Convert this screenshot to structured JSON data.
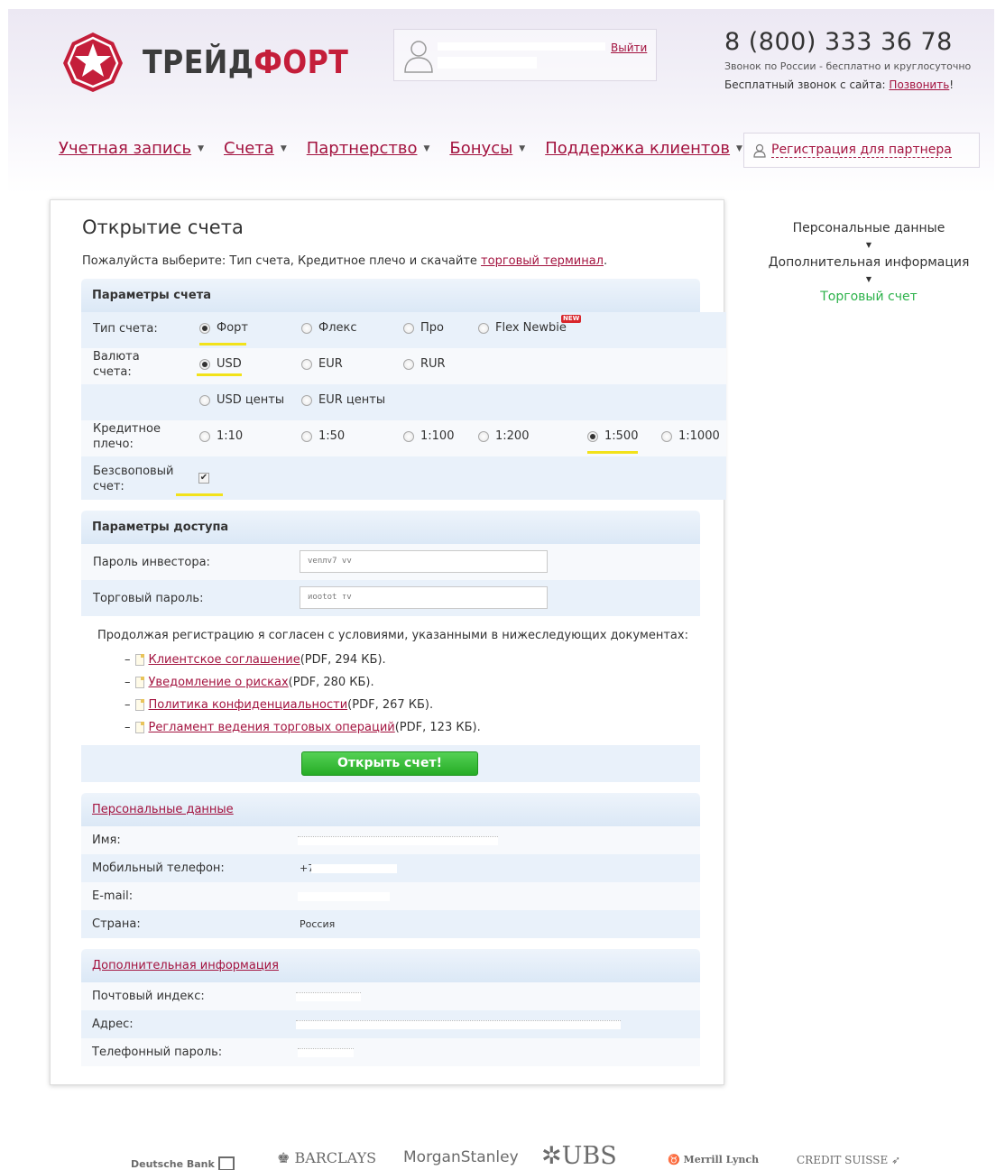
{
  "brand": {
    "name_part1": "ТРЕЙД",
    "name_part2": "ФОРТ",
    "accent_color": "#c41e3a"
  },
  "user": {
    "logout": "Выйти"
  },
  "contact": {
    "phone": "8 (800) 333 36 78",
    "sub1": "Звонок по России - бесплатно и круглосуточно",
    "sub2_prefix": "Бесплатный звонок с сайта: ",
    "sub2_link": "Позвонить",
    "sub2_suffix": "!"
  },
  "nav": [
    {
      "label": "Учетная запись"
    },
    {
      "label": "Счета"
    },
    {
      "label": "Партнерство"
    },
    {
      "label": "Бонусы"
    },
    {
      "label": "Поддержка клиентов"
    }
  ],
  "partner_register": "Регистрация для партнера",
  "steps": [
    {
      "label": "Персональные данные"
    },
    {
      "label": "Дополнительная информация"
    },
    {
      "label": "Торговый счет"
    }
  ],
  "page": {
    "title": "Открытие счета",
    "intro_prefix": "Пожалуйста выберите: Тип счета, Кредитное плечо и скачайте ",
    "intro_link": "торговый терминал",
    "intro_suffix": "."
  },
  "account_params": {
    "heading": "Параметры счета",
    "type_label": "Тип счета:",
    "types": [
      "Форт",
      "Флекс",
      "Про",
      "Flex Newbie"
    ],
    "new_badge": "NEW",
    "currency_label": "Валюта счета:",
    "currencies": [
      "USD",
      "EUR",
      "RUR",
      "USD центы",
      "EUR центы"
    ],
    "leverage_label": "Кредитное плечо:",
    "leverages": [
      "1:10",
      "1:50",
      "1:100",
      "1:200",
      "1:500",
      "1:1000"
    ],
    "swapfree_label": "Безсвоповый счет:"
  },
  "access_params": {
    "heading": "Параметры доступа",
    "investor_label": "Пароль инвестора:",
    "trading_label": "Торговый пароль:",
    "investor_value": "vеnлv7 vv",
    "trading_value": "ᴎᴏᴏtᴏt тv"
  },
  "documents": {
    "lead": "Продолжая регистрацию я согласен с условиями, указанными в нижеследующих документах:",
    "items": [
      {
        "link": "Клиентское соглашение",
        "meta": " (PDF, 294 КБ)."
      },
      {
        "link": "Уведомление о рисках",
        "meta": " (PDF, 280 КБ)."
      },
      {
        "link": "Политика конфиденциальности",
        "meta": " (PDF, 267 КБ)."
      },
      {
        "link": "Регламент ведения торговых операций",
        "meta": " (PDF, 123 КБ)."
      }
    ]
  },
  "open_button": "Открыть счет!",
  "personal": {
    "heading": "Персональные данные",
    "rows": [
      {
        "k": "Имя:",
        "v": ""
      },
      {
        "k": "Мобильный телефон:",
        "v": "+7"
      },
      {
        "k": "E-mail:",
        "v": ""
      },
      {
        "k": "Страна:",
        "v": "Россия"
      }
    ]
  },
  "additional": {
    "heading": "Дополнительная информация",
    "rows": [
      {
        "k": "Почтовый индекс:",
        "v": ""
      },
      {
        "k": "Адрес:",
        "v": ""
      },
      {
        "k": "Телефонный пароль:",
        "v": ""
      }
    ]
  },
  "partners": [
    "Deutsche Bank",
    "BARCLAYS",
    "MorganStanley",
    "UBS",
    "Merrill Lynch",
    "CREDIT SUISSE"
  ]
}
